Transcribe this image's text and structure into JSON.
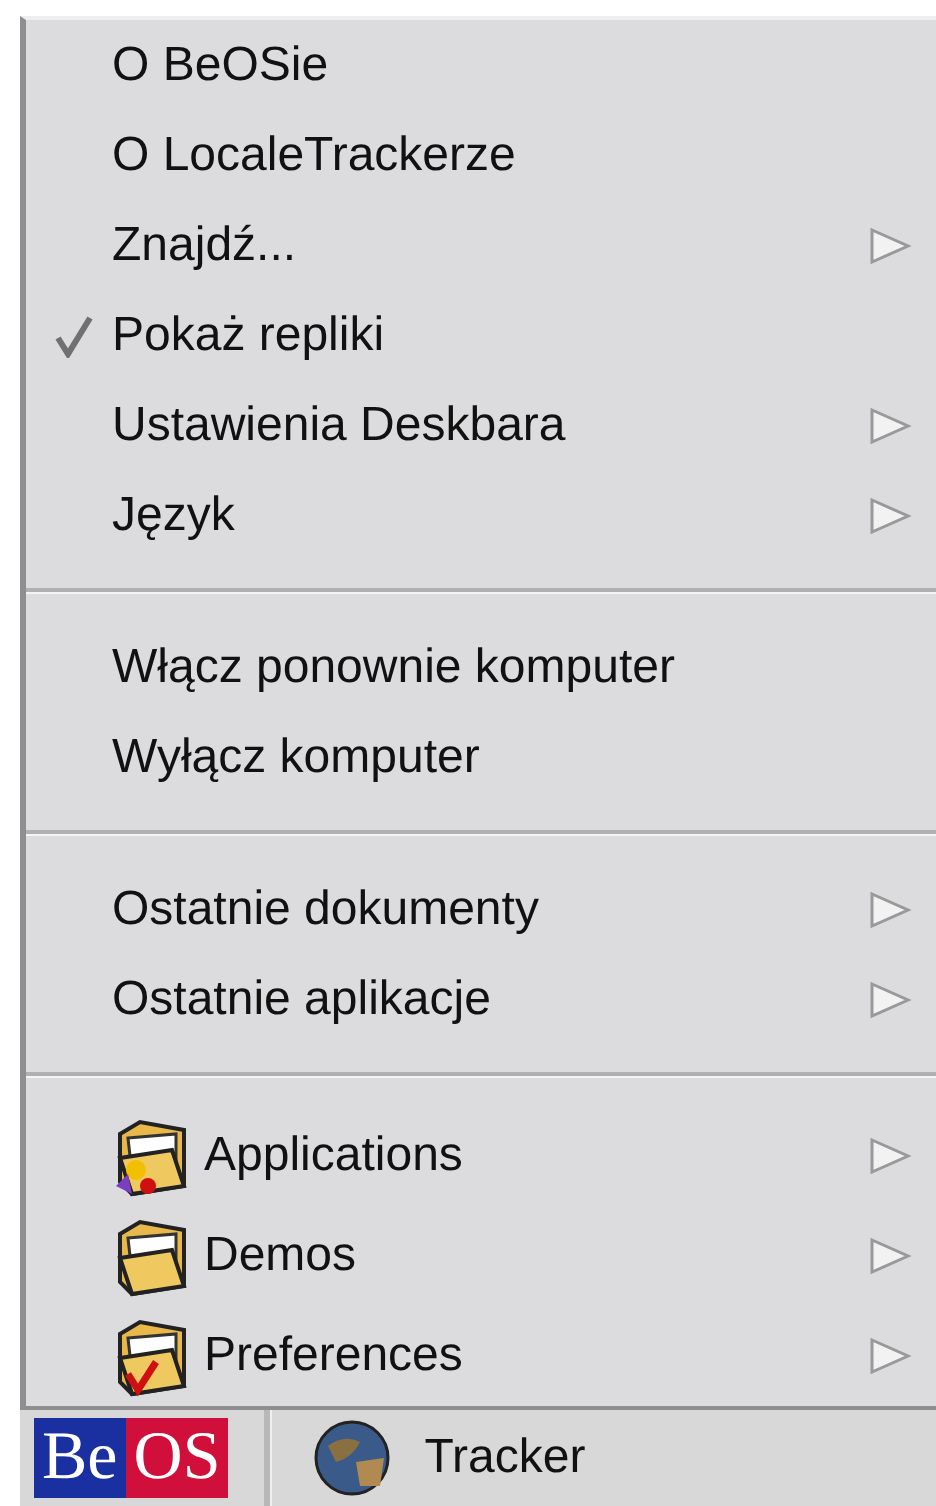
{
  "menu": {
    "sections": [
      {
        "items": [
          {
            "label": "O BeOSie",
            "kind": "plain",
            "checked": false,
            "submenu": false
          },
          {
            "label": "O LocaleTrackerze",
            "kind": "plain",
            "checked": false,
            "submenu": false
          },
          {
            "label": "Znajdź...",
            "kind": "plain",
            "checked": false,
            "submenu": true
          },
          {
            "label": "Pokaż repliki",
            "kind": "plain",
            "checked": true,
            "submenu": false
          },
          {
            "label": "Ustawienia Deskbara",
            "kind": "plain",
            "checked": false,
            "submenu": true
          },
          {
            "label": "Język",
            "kind": "plain",
            "checked": false,
            "submenu": true
          }
        ]
      },
      {
        "items": [
          {
            "label": "Włącz ponownie komputer",
            "kind": "plain",
            "checked": false,
            "submenu": false
          },
          {
            "label": "Wyłącz komputer",
            "kind": "plain",
            "checked": false,
            "submenu": false
          }
        ]
      },
      {
        "items": [
          {
            "label": "Ostatnie dokumenty",
            "kind": "plain",
            "checked": false,
            "submenu": true
          },
          {
            "label": "Ostatnie aplikacje",
            "kind": "plain",
            "checked": false,
            "submenu": true
          }
        ]
      },
      {
        "items": [
          {
            "label": "Applications",
            "kind": "folder",
            "checked": false,
            "submenu": true
          },
          {
            "label": "Demos",
            "kind": "folder",
            "checked": false,
            "submenu": true
          },
          {
            "label": "Preferences",
            "kind": "folder",
            "checked": false,
            "submenu": true
          }
        ]
      }
    ]
  },
  "taskbar": {
    "logo": [
      "Be",
      "OS"
    ],
    "apps": [
      {
        "label": "Tracker"
      }
    ]
  }
}
